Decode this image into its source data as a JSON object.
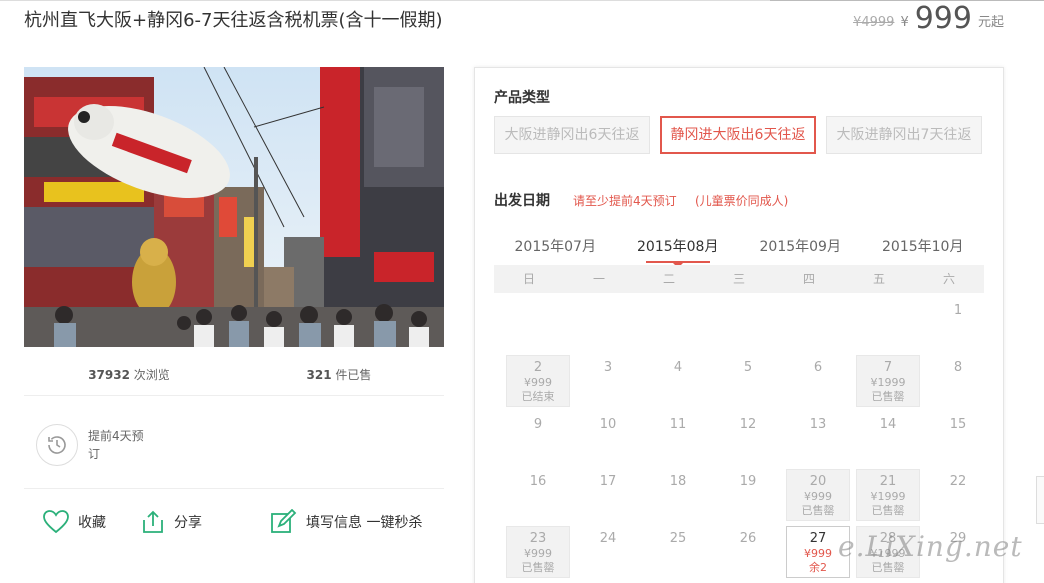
{
  "product": {
    "title": "杭州直飞大阪+静冈6-7天往返含税机票(含十一假期)",
    "old_price": "¥4999",
    "currency": "¥",
    "price": "999",
    "price_unit": "元起"
  },
  "stats": {
    "views_num": "37932",
    "views_label": " 次浏览",
    "sold_num": "321",
    "sold_label": " 件已售"
  },
  "advance": {
    "text": "提前4天预订"
  },
  "actions": {
    "favorite": "收藏",
    "share": "分享",
    "fill_info": "填写信息 一键秒杀"
  },
  "product_types": {
    "label": "产品类型",
    "items": [
      {
        "label": "大阪进静冈出6天往返"
      },
      {
        "label": "静冈进大阪出6天往返"
      },
      {
        "label": "大阪进静冈出7天往返"
      }
    ],
    "selected_index": 1
  },
  "departure": {
    "label": "出发日期",
    "hint": "请至少提前4天预订",
    "hint_child": "(儿童票价同成人)"
  },
  "months": [
    {
      "label": "2015年07月"
    },
    {
      "label": "2015年08月"
    },
    {
      "label": "2015年09月"
    },
    {
      "label": "2015年10月"
    }
  ],
  "selected_month_index": 1,
  "weekdays": [
    "日",
    "一",
    "二",
    "三",
    "四",
    "五",
    "六"
  ],
  "calendar": [
    [
      {
        "day": ""
      },
      {
        "day": ""
      },
      {
        "day": ""
      },
      {
        "day": ""
      },
      {
        "day": ""
      },
      {
        "day": ""
      },
      {
        "day": "1"
      }
    ],
    [
      {
        "day": "2",
        "price": "¥999",
        "status": "已结束",
        "state": "off"
      },
      {
        "day": "3"
      },
      {
        "day": "4"
      },
      {
        "day": "5"
      },
      {
        "day": "6"
      },
      {
        "day": "7",
        "price": "¥1999",
        "status": "已售罄",
        "state": "off"
      },
      {
        "day": "8"
      }
    ],
    [
      {
        "day": "9"
      },
      {
        "day": "10"
      },
      {
        "day": "11"
      },
      {
        "day": "12"
      },
      {
        "day": "13"
      },
      {
        "day": "14"
      },
      {
        "day": "15"
      }
    ],
    [
      {
        "day": "16"
      },
      {
        "day": "17"
      },
      {
        "day": "18"
      },
      {
        "day": "19"
      },
      {
        "day": "20",
        "price": "¥999",
        "status": "已售罄",
        "state": "off"
      },
      {
        "day": "21",
        "price": "¥1999",
        "status": "已售罄",
        "state": "off"
      },
      {
        "day": "22"
      }
    ],
    [
      {
        "day": "23",
        "price": "¥999",
        "status": "已售罄",
        "state": "off"
      },
      {
        "day": "24"
      },
      {
        "day": "25"
      },
      {
        "day": "26"
      },
      {
        "day": "27",
        "price": "¥999",
        "status": "余2",
        "state": "sel"
      },
      {
        "day": "28",
        "price": "¥1999",
        "status": "已售罄",
        "state": "off"
      },
      {
        "day": "29"
      }
    ]
  ],
  "watermark": "e.LiXing.net",
  "colors": {
    "accent": "#e2574c",
    "action_green": "#2bb07a"
  }
}
